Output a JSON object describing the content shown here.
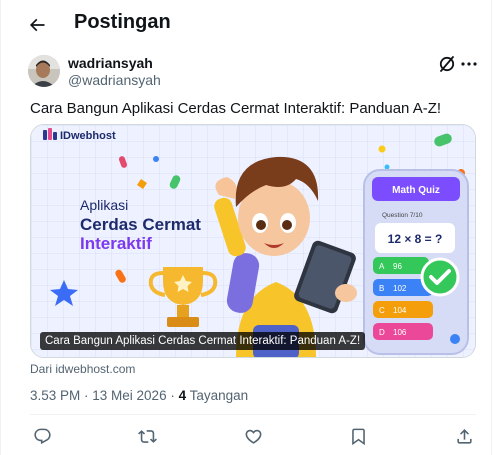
{
  "header": {
    "title": "Postingan"
  },
  "post": {
    "author_name": "wadriansyah",
    "author_handle": "@wadriansyah",
    "text": "Cara Bangun Aplikasi Cerdas Cermat Interaktif: Panduan A-Z!"
  },
  "card": {
    "brand": "IDwebhost",
    "headline_line1": "Aplikasi",
    "headline_line2": "Cerdas Cermat",
    "headline_line3": "Interaktif",
    "quiz_title": "Math Quiz",
    "quiz_question_no": "Question 7/10",
    "quiz_question": "12 × 8 = ?",
    "quiz_options": [
      {
        "letter": "A",
        "value": "96"
      },
      {
        "letter": "B",
        "value": "102"
      },
      {
        "letter": "C",
        "value": "104"
      },
      {
        "letter": "D",
        "value": "106"
      }
    ],
    "caption": "Cara Bangun Aplikasi Cerdas Cermat Interaktif: Panduan A-Z!",
    "source": "Dari idwebhost.com"
  },
  "meta": {
    "time": "3.53 PM · 13 Mei 2026 · ",
    "views_count": "4",
    "views_label": " Tayangan"
  },
  "icons": [
    "back-arrow-icon",
    "grok-icon",
    "more-icon",
    "reply-icon",
    "retweet-icon",
    "like-icon",
    "bookmark-icon",
    "share-icon"
  ],
  "colors": {
    "text": "#0f1419",
    "secondary": "#536471",
    "border": "#cfd9de",
    "divider": "#eff3f4",
    "quiz_purple": "#7c4dff"
  }
}
